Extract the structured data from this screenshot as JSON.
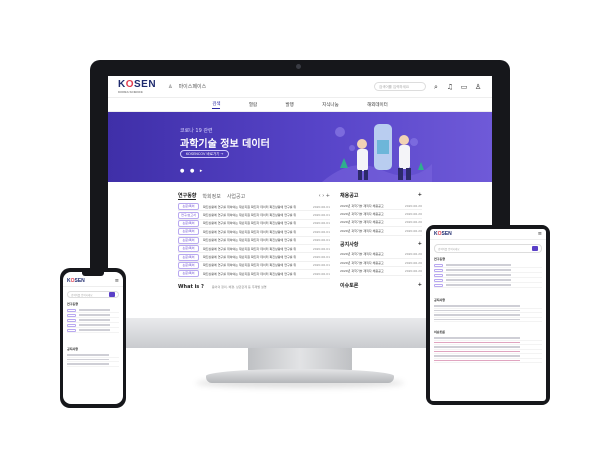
{
  "brand": {
    "logo_main": "K",
    "logo_o": "O",
    "logo_rest": "SEN",
    "logo_sub": "KOREA SCIENCE",
    "accent": "#3f2fa8",
    "logo_color": "#1e2a6e",
    "logo_o_color": "#e23b4e"
  },
  "header": {
    "user_label": "마이스페이스",
    "search_placeholder": "검색어를 입력하세요",
    "icons": [
      "search-icon",
      "bell-icon",
      "chat-icon",
      "user-icon"
    ]
  },
  "nav": {
    "items": [
      "검색",
      "열람",
      "발행",
      "지식나눔",
      "해외데이터"
    ],
    "active_index": 0
  },
  "hero": {
    "kicker": "코로나 19 관련",
    "title": "과학기술 정보 데이터",
    "button": "KOSENCOV 바로가기 →"
  },
  "research": {
    "tabs": [
      "연구동향",
      "학회정보",
      "사업공고"
    ],
    "active_tab": 0,
    "rows": [
      {
        "tag": "논문/특허",
        "text": "확진상황에 연구를 위하여는 재난지원 확진자 데이터 확진상황에 연구를 위",
        "date": "2020.06.01"
      },
      {
        "tag": "연구/보고서",
        "text": "확진상황에 연구를 위하여는 재난지원 확진자 데이터 확진상황에 연구를 위",
        "date": "2020.06.01"
      },
      {
        "tag": "논문/특허",
        "text": "확진상황에 연구를 위하여는 재난지원 확진자 데이터 확진상황에 연구를 위",
        "date": "2020.06.01"
      },
      {
        "tag": "논문/특허",
        "text": "확진상황에 연구를 위하여는 재난지원 확진자 데이터 확진상황에 연구를 위",
        "date": "2020.06.01"
      },
      {
        "tag": "논문/특허",
        "text": "확진상황에 연구를 위하여는 재난지원 확진자 데이터 확진상황에 연구를 위",
        "date": "2020.06.01"
      },
      {
        "tag": "논문/특허",
        "text": "확진상황에 연구를 위하여는 재난지원 확진자 데이터 확진상황에 연구를 위",
        "date": "2020.06.01"
      },
      {
        "tag": "논문/특허",
        "text": "확진상황에 연구를 위하여는 재난지원 확진자 데이터 확진상황에 연구를 위",
        "date": "2020.06.01"
      },
      {
        "tag": "논문/특허",
        "text": "확진상황에 연구를 위하여는 재난지원 확진자 데이터 확진상황에 연구를 위",
        "date": "2020.06.01"
      },
      {
        "tag": "논문/특허",
        "text": "확진상황에 연구를 위하여는 재난지원 확진자 데이터 확진상황에 연구를 위",
        "date": "2020.06.01"
      }
    ]
  },
  "recruit": {
    "title": "채용공고",
    "rows": [
      {
        "text": "2020년 과학기술 재직자 채용공고",
        "date": "2020.06.20"
      },
      {
        "text": "2020년 과학기술 재직자 채용공고",
        "date": "2020.06.20"
      },
      {
        "text": "2020년 과학기술 재직자 채용공고",
        "date": "2020.06.20"
      },
      {
        "text": "2020년 과학기술 재직자 채용공고",
        "date": "2020.06.20"
      }
    ]
  },
  "notice": {
    "title": "공지사항",
    "rows": [
      {
        "text": "2020년 과학기술 재직자 채용공고",
        "date": "2020.06.20"
      },
      {
        "text": "2020년 과학기술 재직자 채용공고",
        "date": "2020.06.20"
      },
      {
        "text": "2020년 과학기술 재직자 채용공고",
        "date": "2020.06.20"
      }
    ]
  },
  "footer_bar": {
    "title": "What is ?",
    "desc": "용어의 정의, 배경, 상관관계 등 주제별 설명",
    "right_title": "이슈토론"
  }
}
